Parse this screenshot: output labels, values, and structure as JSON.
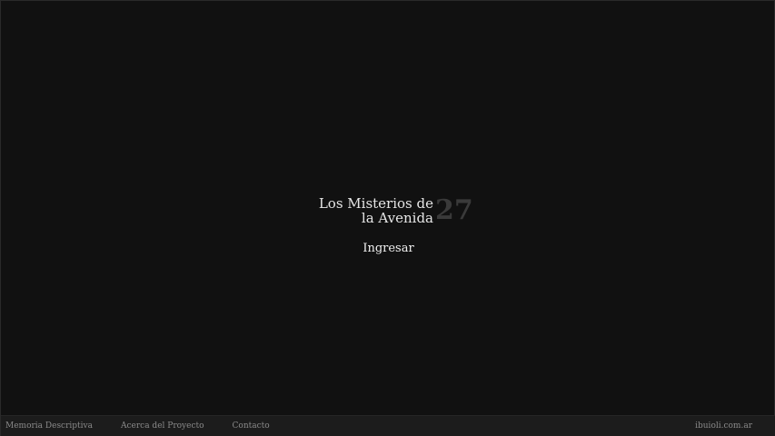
{
  "logo": {
    "line1": "Los Misterios de",
    "line2": "la Avenida",
    "number": "27"
  },
  "entry": {
    "label": "Ingresar"
  },
  "footer": {
    "links": [
      {
        "label": "Memoria Descriptiva"
      },
      {
        "label": "Acerca del Proyecto"
      },
      {
        "label": "Contacto"
      }
    ],
    "credit": "ibuioli.com.ar"
  },
  "colors": {
    "background": "#111111",
    "footer_background": "#1c1c1c",
    "logo_text": "#e6e6e6",
    "logo_number": "#3a3a3a",
    "footer_text": "#8a8a8a"
  }
}
